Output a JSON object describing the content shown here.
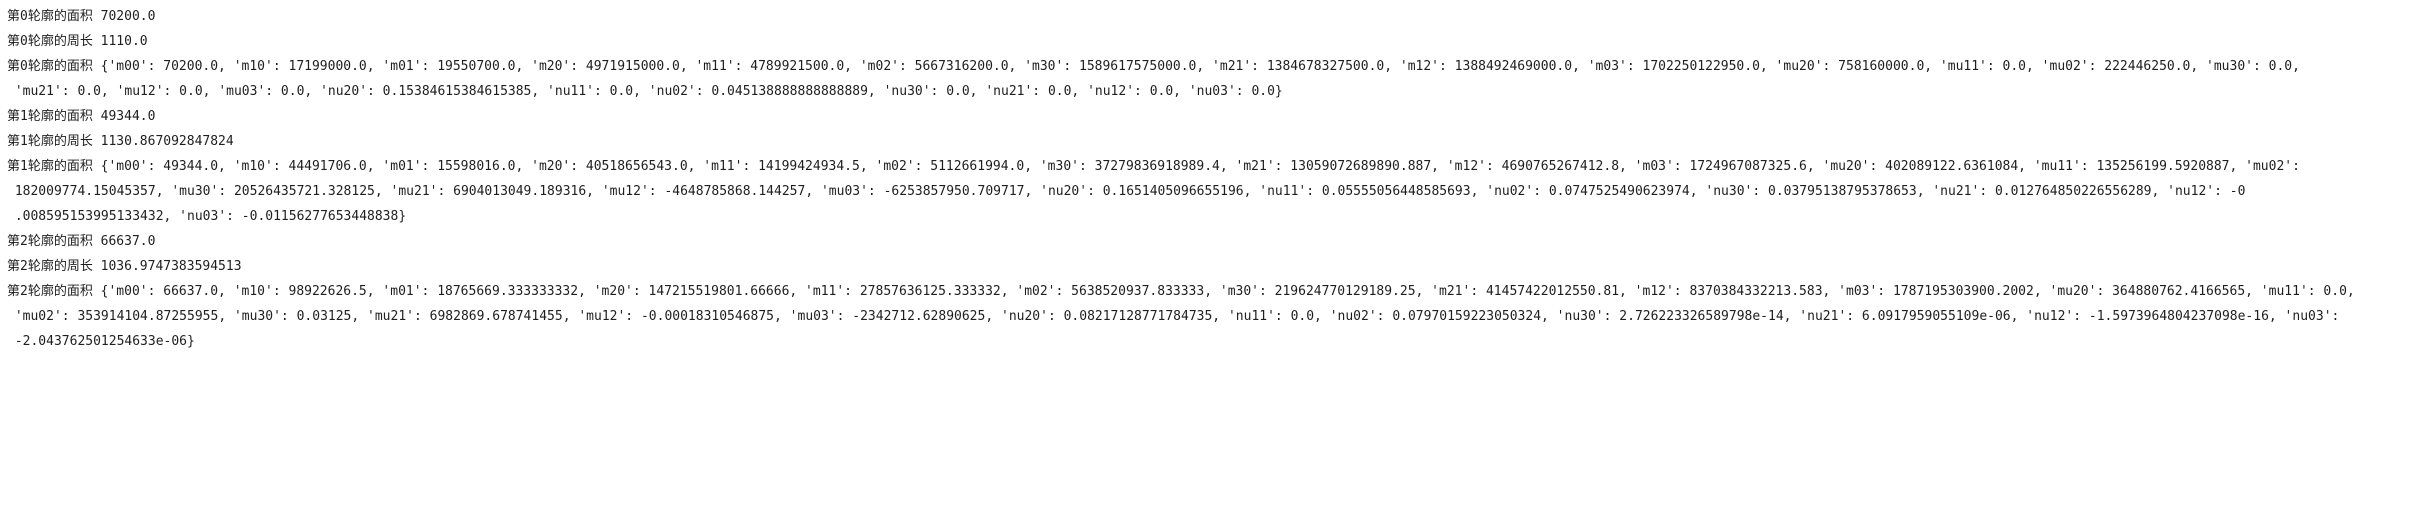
{
  "console": {
    "lines": [
      "第0轮廓的面积 70200.0",
      "第0轮廓的周长 1110.0",
      "第0轮廓的面积 {'m00': 70200.0, 'm10': 17199000.0, 'm01': 19550700.0, 'm20': 4971915000.0, 'm11': 4789921500.0, 'm02': 5667316200.0, 'm30': 1589617575000.0, 'm21': 1384678327500.0, 'm12': 1388492469000.0, 'm03': 1702250122950.0, 'mu20': 758160000.0, 'mu11': 0.0, 'mu02': 222446250.0, 'mu30': 0.0,",
      " 'mu21': 0.0, 'mu12': 0.0, 'mu03': 0.0, 'nu20': 0.15384615384615385, 'nu11': 0.0, 'nu02': 0.045138888888888889, 'nu30': 0.0, 'nu21': 0.0, 'nu12': 0.0, 'nu03': 0.0}",
      "第1轮廓的面积 49344.0",
      "第1轮廓的周长 1130.867092847824",
      "第1轮廓的面积 {'m00': 49344.0, 'm10': 44491706.0, 'm01': 15598016.0, 'm20': 40518656543.0, 'm11': 14199424934.5, 'm02': 5112661994.0, 'm30': 37279836918989.4, 'm21': 13059072689890.887, 'm12': 4690765267412.8, 'm03': 1724967087325.6, 'mu20': 402089122.6361084, 'mu11': 135256199.5920887, 'mu02':",
      " 182009774.15045357, 'mu30': 20526435721.328125, 'mu21': 6904013049.189316, 'mu12': -4648785868.144257, 'mu03': -6253857950.709717, 'nu20': 0.1651405096655196, 'nu11': 0.05555056448585693, 'nu02': 0.0747525490623974, 'nu30': 0.03795138795378653, 'nu21': 0.012764850226556289, 'nu12': -0",
      " .008595153995133432, 'nu03': -0.01156277653448838}",
      "第2轮廓的面积 66637.0",
      "第2轮廓的周长 1036.9747383594513",
      "第2轮廓的面积 {'m00': 66637.0, 'm10': 98922626.5, 'm01': 18765669.333333332, 'm20': 147215519801.66666, 'm11': 27857636125.333332, 'm02': 5638520937.833333, 'm30': 219624770129189.25, 'm21': 41457422012550.81, 'm12': 8370384332213.583, 'm03': 1787195303900.2002, 'mu20': 364880762.4166565, 'mu11': 0.0,",
      " 'mu02': 353914104.87255955, 'mu30': 0.03125, 'mu21': 6982869.678741455, 'mu12': -0.00018310546875, 'mu03': -2342712.62890625, 'nu20': 0.08217128771784735, 'nu11': 0.0, 'nu02': 0.07970159223050324, 'nu30': 2.726223326589798e-14, 'nu21': 6.0917959055109e-06, 'nu12': -1.5973964804237098e-16, 'nu03':",
      " -2.043762501254633e-06}"
    ]
  }
}
